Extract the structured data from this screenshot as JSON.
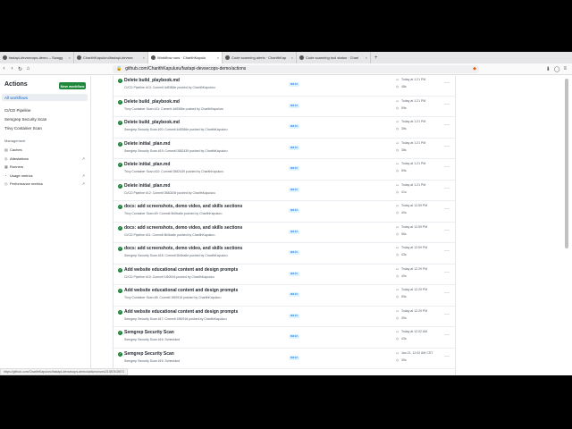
{
  "tabs": [
    {
      "label": "fastapi-devsecops-demo – Swagg",
      "active": false
    },
    {
      "label": "CharithKapuluru/fastapi-devsec",
      "active": false
    },
    {
      "label": "Workflow runs · CharithKapulu",
      "active": true
    },
    {
      "label": "Code scanning alerts · CharithKap",
      "active": false
    },
    {
      "label": "Code scanning tool status · Chari",
      "active": false
    }
  ],
  "url": "github.com/CharithKapuluru/fastapi-devsecops-demo/actions",
  "sidebar": {
    "title": "Actions",
    "new_workflow": "New workflow",
    "all_workflows": "All workflows",
    "workflows": [
      "CI/CD Pipeline",
      "Semgrep Security Scan",
      "Trivy Container Scan"
    ],
    "management_label": "Management",
    "management": [
      {
        "label": "Caches",
        "icon": "caches-icon",
        "external": false
      },
      {
        "label": "Attestations",
        "icon": "attestations-icon",
        "external": true
      },
      {
        "label": "Runners",
        "icon": "runners-icon",
        "external": false
      },
      {
        "label": "Usage metrics",
        "icon": "usage-icon",
        "external": true
      },
      {
        "label": "Performance metrics",
        "icon": "performance-icon",
        "external": true
      }
    ]
  },
  "runs": [
    {
      "title": "Delete build_playbook.md",
      "meta": "CI/CD Pipeline #13: Commit 4d5366e pushed by CharithKapuluru",
      "branch": "main",
      "time": "Today at 1:21 PM",
      "duration": "48s"
    },
    {
      "title": "Delete build_playbook.md",
      "meta": "Trivy Container Scan #11: Commit 4d5366e pushed by CharithKapuluru",
      "branch": "main",
      "time": "Today at 1:21 PM",
      "duration": "59s"
    },
    {
      "title": "Delete build_playbook.md",
      "meta": "Semgrep Security Scan #20: Commit 4d5366e pushed by CharithKapuluru",
      "branch": "main",
      "time": "Today at 1:21 PM",
      "duration": "35s"
    },
    {
      "title": "Delete initial_plan.md",
      "meta": "Semgrep Security Scan #19: Commit 0582439 pushed by CharithKapuluru",
      "branch": "main",
      "time": "Today at 1:21 PM",
      "duration": "38s"
    },
    {
      "title": "Delete initial_plan.md",
      "meta": "Trivy Container Scan #10: Commit 0582439 pushed by CharithKapuluru",
      "branch": "main",
      "time": "Today at 1:21 PM",
      "duration": "59s"
    },
    {
      "title": "Delete initial_plan.md",
      "meta": "CI/CD Pipeline #12: Commit 0582439 pushed by CharithKapuluru",
      "branch": "main",
      "time": "Today at 1:21 PM",
      "duration": "41s"
    },
    {
      "title": "docs: add screenshots, demo video, and skills sections",
      "meta": "Trivy Container Scan #9: Commit 5b0ba6e pushed by CharithKapuluru",
      "branch": "main",
      "time": "Today at 12:59 PM",
      "duration": "40s"
    },
    {
      "title": "docs: add screenshots, demo video, and skills sections",
      "meta": "CI/CD Pipeline #11: Commit 5b0ba6e pushed by CharithKapuluru",
      "branch": "main",
      "time": "Today at 12:59 PM",
      "duration": "56s"
    },
    {
      "title": "docs: add screenshots, demo video, and skills sections",
      "meta": "Semgrep Security Scan #18: Commit 5b0ba6e pushed by CharithKapuluru",
      "branch": "main",
      "time": "Today at 12:59 PM",
      "duration": "43s"
    },
    {
      "title": "Add website educational content and design prompts",
      "meta": "CI/CD Pipeline #10: Commit 1f60916 pushed by CharithKapuluru",
      "branch": "main",
      "time": "Today at 12:29 PM",
      "duration": "40s"
    },
    {
      "title": "Add website educational content and design prompts",
      "meta": "Trivy Container Scan #8: Commit 1f60916 pushed by CharithKapuluru",
      "branch": "main",
      "time": "Today at 12:29 PM",
      "duration": "59s"
    },
    {
      "title": "Add website educational content and design prompts",
      "meta": "Semgrep Security Scan #17: Commit 1f60916 pushed by CharithKapuluru",
      "branch": "main",
      "time": "Today at 12:29 PM",
      "duration": "39s"
    },
    {
      "title": "Semgrep Security Scan",
      "meta": "Semgrep Security Scan #16: Scheduled",
      "branch": "main",
      "time": "Today at 12:02 AM",
      "duration": "43s"
    },
    {
      "title": "Semgrep Security Scan",
      "meta": "Semgrep Security Scan #15: Scheduled",
      "branch": "main",
      "time": "Jan 21, 12:02 AM CST",
      "duration": "39s"
    }
  ],
  "status_url": "https://github.com/CharithKapuluru/fastapi-devsecops-demo/actions/runs/21087403571"
}
